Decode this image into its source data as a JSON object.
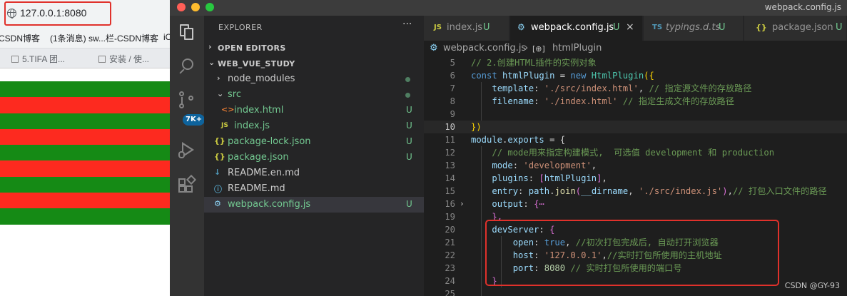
{
  "browser": {
    "url": "127.0.0.1:8080",
    "bookmarks": [
      "CSDN博客",
      "(1条消息) sw...栏-CSDN博客",
      "iC"
    ],
    "tabs": [
      "5.TIFA 团...",
      "安装 / 使..."
    ],
    "stripe_colors": [
      "#158a15",
      "#fd2a1f"
    ]
  },
  "window": {
    "title": "webpack.config.js",
    "traffic_colors": [
      "#ff5f57",
      "#febc2e",
      "#28c840"
    ]
  },
  "activity": {
    "badge": "7K+",
    "icons": [
      "files-icon",
      "search-icon",
      "source-control-icon",
      "run-debug-icon",
      "extensions-icon"
    ]
  },
  "explorer": {
    "title": "EXPLORER",
    "more": "···",
    "open_editors": "OPEN EDITORS",
    "project": "WEB_VUE_STUDY",
    "items": [
      {
        "name": "node_modules",
        "icon": "›",
        "status": "dot"
      },
      {
        "name": "src",
        "icon": "⌄",
        "status": "dot"
      },
      {
        "name": "index.html",
        "icon": "<>",
        "status": "U"
      },
      {
        "name": "index.js",
        "icon": "JS",
        "status": "U"
      },
      {
        "name": "package-lock.json",
        "icon": "{}",
        "status": "U"
      },
      {
        "name": "package.json",
        "icon": "{}",
        "status": "U"
      },
      {
        "name": "README.en.md",
        "icon": "↓",
        "status": ""
      },
      {
        "name": "README.md",
        "icon": "ⓘ",
        "status": ""
      },
      {
        "name": "webpack.config.js",
        "icon": "⚙",
        "status": "U"
      }
    ]
  },
  "editor": {
    "tabs": [
      {
        "icon": "JS",
        "name": "index.js",
        "status": "U"
      },
      {
        "icon": "⚙",
        "name": "webpack.config.js",
        "status": "U",
        "close": "×"
      },
      {
        "icon": "TS",
        "name": "typings.d.ts",
        "status": "U"
      },
      {
        "icon": "{}",
        "name": "package.json",
        "status": "U"
      }
    ],
    "breadcrumb": {
      "file": "webpack.config.js",
      "sep": "›",
      "symbol_icon": "[⊕]",
      "symbol": "htmlPlugin"
    },
    "line_numbers": [
      "5",
      "6",
      "7",
      "8",
      "9",
      "10",
      "11",
      "12",
      "13",
      "14",
      "15",
      "16",
      "19",
      "20",
      "21",
      "22",
      "23",
      "24",
      "25"
    ],
    "code": {
      "l5": "// 2.创建HTML插件的实例对象",
      "l6_kw": "const",
      "l6_var": "htmlPlugin",
      "l6_eq": " = ",
      "l6_new": "new",
      "l6_cls": "HtmlPlugin",
      "l6_open": "({",
      "l7_key": "template",
      "l7_val": "'./src/index.html'",
      "l7_cm": "// 指定源文件的存放路径",
      "l8_key": "filename",
      "l8_val": "'./index.html'",
      "l8_cm": "// 指定生成文件的存放路径",
      "l10_close": "})",
      "l11_obj": "module",
      "l11_prop": "exports",
      "l11_rest": " = {",
      "l12_cm": "// mode用来指定构建模式,  可选值 development 和 production",
      "l13_key": "mode",
      "l13_val": "'development'",
      "l14_key": "plugins",
      "l14_val": "htmlPlugin",
      "l15_key": "entry",
      "l15_obj": "path",
      "l15_fn": "join",
      "l15_arg1": "__dirname",
      "l15_arg2": "'./src/index.js'",
      "l15_cm": "// 打包入口文件的路径",
      "l16_key": "output",
      "l16_fold": "{⋯",
      "l19_close": "},",
      "l20_key": "devServer",
      "l21_key": "open",
      "l21_val": "true",
      "l21_cm": "//初次打包完成后, 自动打开浏览器",
      "l22_key": "host",
      "l22_val": "'127.0.0.1'",
      "l22_cm": "//实时打包所使用的主机地址",
      "l23_key": "port",
      "l23_val": "8080",
      "l23_cm": "// 实时打包所使用的端口号"
    }
  },
  "watermark": "CSDN @GY-93"
}
